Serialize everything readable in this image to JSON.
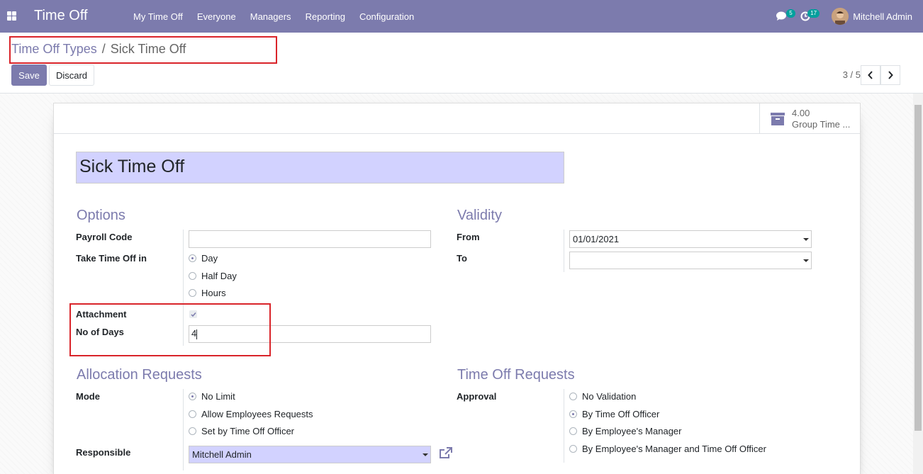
{
  "navbar": {
    "brand": "Time Off",
    "menu": [
      "My Time Off",
      "Everyone",
      "Managers",
      "Reporting",
      "Configuration"
    ],
    "messages_count": "5",
    "activities_count": "17",
    "user_name": "Mitchell Admin"
  },
  "breadcrumb": {
    "parent": "Time Off Types",
    "separator": "/",
    "current": "Sick Time Off"
  },
  "actions": {
    "save": "Save",
    "discard": "Discard"
  },
  "pager": {
    "value": "3 / 5"
  },
  "stat_button": {
    "value": "4.00",
    "label": "Group Time ..."
  },
  "form": {
    "name": "Sick Time Off",
    "options": {
      "title": "Options",
      "payroll_code_label": "Payroll Code",
      "payroll_code_value": "",
      "take_time_off_label": "Take Time Off in",
      "take_time_off_options": [
        "Day",
        "Half Day",
        "Hours"
      ],
      "take_time_off_selected": "Day",
      "attachment_label": "Attachment",
      "attachment_checked": true,
      "no_of_days_label": "No of Days",
      "no_of_days_value": "4"
    },
    "validity": {
      "title": "Validity",
      "from_label": "From",
      "from_value": "01/01/2021",
      "to_label": "To",
      "to_value": ""
    },
    "allocation": {
      "title": "Allocation Requests",
      "mode_label": "Mode",
      "mode_options": [
        "No Limit",
        "Allow Employees Requests",
        "Set by Time Off Officer"
      ],
      "mode_selected": "No Limit",
      "responsible_label": "Responsible",
      "responsible_value": "Mitchell Admin"
    },
    "requests": {
      "title": "Time Off Requests",
      "approval_label": "Approval",
      "approval_options": [
        "No Validation",
        "By Time Off Officer",
        "By Employee's Manager",
        "By Employee's Manager and Time Off Officer"
      ],
      "approval_selected": "By Time Off Officer"
    }
  },
  "colors": {
    "primary": "#7c7bad",
    "highlight": "#d9242a",
    "title_field_bg": "#d2d2ff",
    "badge": "#00a09d"
  }
}
